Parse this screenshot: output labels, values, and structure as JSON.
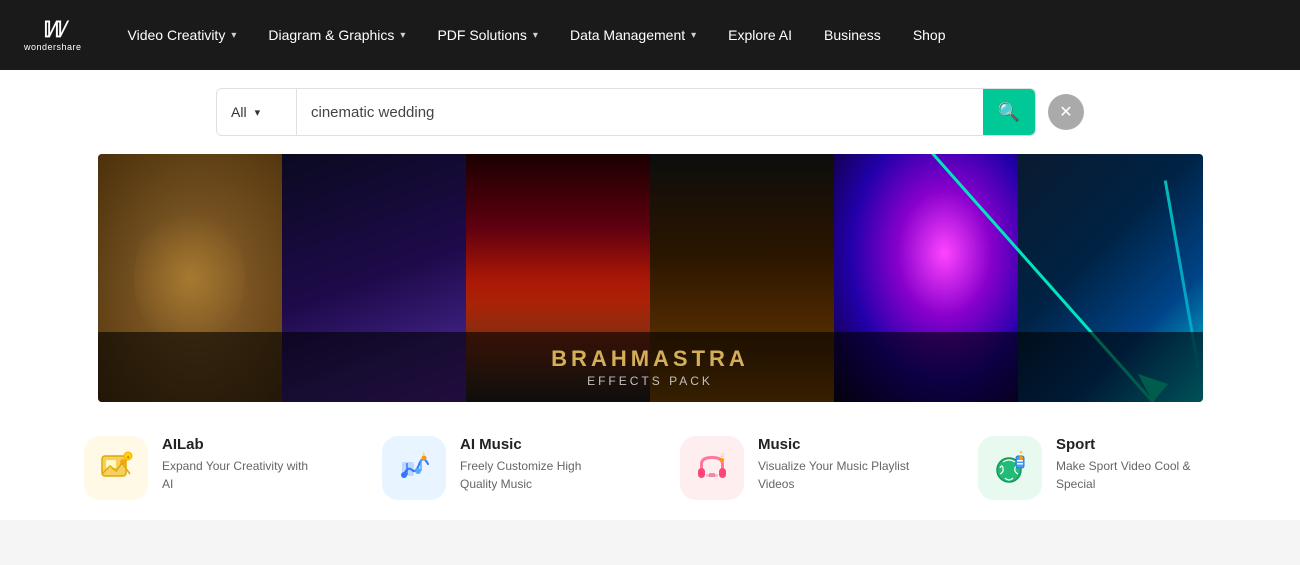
{
  "brand": {
    "name": "wondershare",
    "logo_symbol": "W"
  },
  "nav": {
    "items": [
      {
        "label": "Video Creativity",
        "has_dropdown": true
      },
      {
        "label": "Diagram & Graphics",
        "has_dropdown": true
      },
      {
        "label": "PDF Solutions",
        "has_dropdown": true
      },
      {
        "label": "Data Management",
        "has_dropdown": true
      },
      {
        "label": "Explore AI",
        "has_dropdown": false
      },
      {
        "label": "Business",
        "has_dropdown": false
      },
      {
        "label": "Shop",
        "has_dropdown": false
      }
    ]
  },
  "search": {
    "dropdown_value": "All",
    "input_value": "cinematic wedding",
    "search_button_icon": "🔍"
  },
  "banner": {
    "title": "BRAHMASTRA",
    "subtitle": "EFFECTS PACK"
  },
  "categories": [
    {
      "id": "ailab",
      "title": "AILab",
      "desc": "Expand Your Creativity with AI",
      "icon_bg": "icon-ailab",
      "icon": "🖼️"
    },
    {
      "id": "aimusic",
      "title": "AI Music",
      "desc": "Freely Customize High Quality Music",
      "icon_bg": "icon-aimusic",
      "icon": "🎵"
    },
    {
      "id": "music",
      "title": "Music",
      "desc": "Visualize Your Music Playlist Videos",
      "icon_bg": "icon-music",
      "icon": "🎧"
    },
    {
      "id": "sport",
      "title": "Sport",
      "desc": "Make Sport Video Cool & Special",
      "icon_bg": "icon-sport",
      "icon": "⚽"
    }
  ]
}
